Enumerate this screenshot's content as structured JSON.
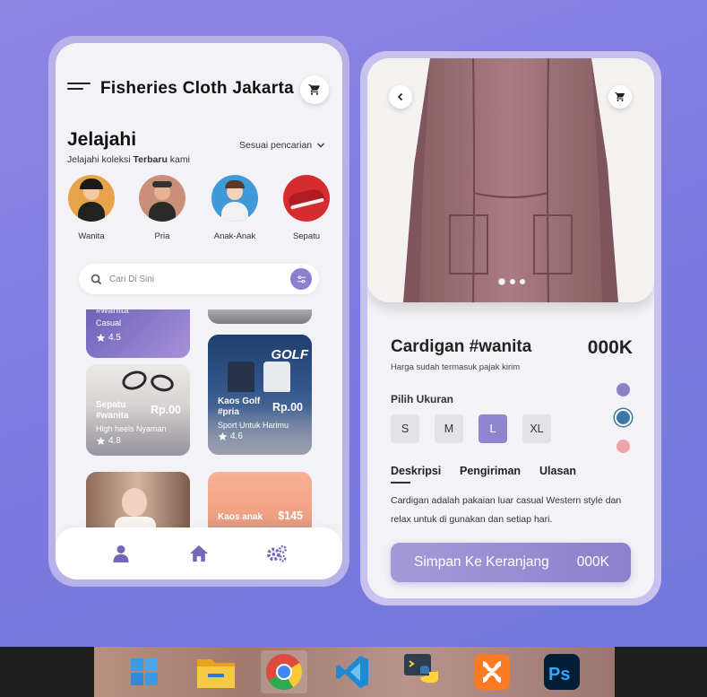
{
  "left_app": {
    "title": "Fisheries Cloth Jakarta",
    "explore": {
      "title": "Jelajahi",
      "subtitle_prefix": "Jelajahi koleksi ",
      "subtitle_bold": "Terbaru",
      "subtitle_suffix": " kami",
      "sort_label": "Sesuai pencarian"
    },
    "categories": [
      {
        "label": "Wanita",
        "color": "#e8a34a"
      },
      {
        "label": "Pria",
        "color": "#c98f79"
      },
      {
        "label": "Anak-Anak",
        "color": "#3e9ad8"
      },
      {
        "label": "Sepatu",
        "color": "#d62b2f"
      }
    ],
    "search": {
      "placeholder": "Cari Di Sini"
    },
    "products": [
      {
        "name": "#wanita",
        "desc": "Casual",
        "rating": "4.5"
      },
      {
        "name": "Sepatu #wanita",
        "price": "Rp.00",
        "desc": "High heels Nyaman",
        "rating": "4.8"
      },
      {
        "name": "Kaos Golf #pria",
        "price": "Rp.00",
        "desc": "Sport Untuk Harimu",
        "rating": "4.6",
        "banner": "GOLF"
      },
      {
        "name": "Kaos anak",
        "price": "$145"
      }
    ],
    "bottom_nav": [
      "user-icon",
      "home-icon",
      "settings-icon"
    ]
  },
  "right_app": {
    "product_title": "Cardigan #wanita",
    "price": "000K",
    "tax_note": "Harga sudah termasuk pajak kirim",
    "size_title": "Pilih Ukuran",
    "sizes": [
      "S",
      "M",
      "L",
      "XL"
    ],
    "selected_size": "L",
    "colors": [
      "#8f7fc4",
      "#3b78a6",
      "#f0a3a8"
    ],
    "selected_color": "#3b78a6",
    "tabs": [
      "Deskripsi",
      "Pengiriman",
      "Ulasan"
    ],
    "active_tab": "Deskripsi",
    "description": "Cardigan adalah pakaian luar casual Western style dan relax untuk di gunakan dan setiap hari.",
    "cta": {
      "label": "Simpan Ke Keranjang",
      "price": "000K"
    },
    "image_dots": 3,
    "active_dot": 0
  },
  "taskbar": {
    "apps": [
      "windows-start-icon",
      "file-explorer-icon",
      "chrome-icon",
      "vscode-icon",
      "python-icon",
      "xampp-icon",
      "photoshop-icon"
    ]
  }
}
